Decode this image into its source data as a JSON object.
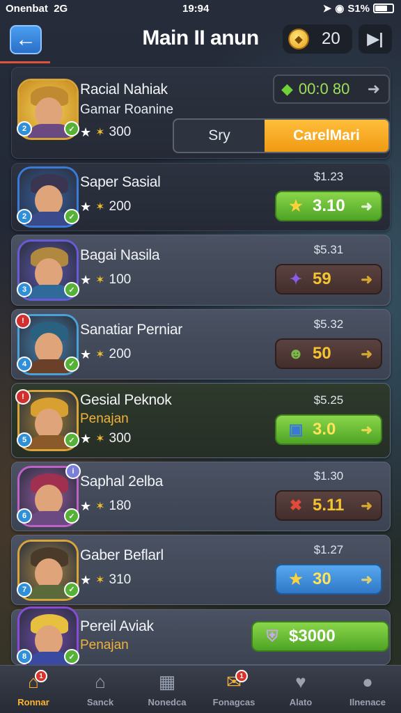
{
  "status": {
    "carrier": "Onenbat",
    "network": "2G",
    "time": "19:94",
    "battery": "S1%"
  },
  "header": {
    "title": "Main II anun",
    "coins": "20",
    "back_icon": "arrow-left-icon",
    "skip_icon": "skip-icon"
  },
  "top_card": {
    "name": "Racial Nahiak",
    "subtitle": "Gamar Roanine",
    "rating": "300",
    "timer": "00:0 80",
    "toggle_left": "Sry",
    "toggle_right": "CarelMari"
  },
  "items": [
    {
      "name": "Saper Sasial",
      "rating": "200",
      "price": "$1.23",
      "button": "3.10",
      "btn_style": "green",
      "icon": "star-icon",
      "hair": "#3a3550",
      "body": "#3a4a8a",
      "frame": "#3a7ad8"
    },
    {
      "name": "Bagai Nasila",
      "rating": "100",
      "price": "$5.31",
      "button": "59",
      "btn_style": "brown",
      "icon": "puzzle-icon",
      "hair": "#b08840",
      "body": "#2f6a9a",
      "frame": "#6a5ad8"
    },
    {
      "name": "Sanatiar Perniar",
      "rating": "200",
      "price": "$5.32",
      "button": "50",
      "btn_style": "brown",
      "icon": "character-icon",
      "hair": "#2a6080",
      "body": "#6a4028",
      "frame": "#4aa0d8"
    },
    {
      "name": "Gesial Peknok",
      "subtitle": "Penajan",
      "rating": "300",
      "price": "$5.25",
      "button": "3.0",
      "btn_style": "green",
      "icon": "card-icon",
      "hair": "#d8a030",
      "body": "#8a5a2a",
      "frame": "#d9a438"
    },
    {
      "name": "Saphal 2elba",
      "rating": "180",
      "price": "$1.30",
      "button": "5.11",
      "btn_style": "brown",
      "icon": "cross-icon",
      "hair": "#a03050",
      "body": "#6a4a80",
      "frame": "#c060c8"
    },
    {
      "name": "Gaber Beflarl",
      "rating": "310",
      "price": "$1.27",
      "button": "30",
      "btn_style": "blue",
      "icon": "star-icon",
      "hair": "#4a3a2a",
      "body": "#5a6a3a",
      "frame": "#d9a438"
    },
    {
      "name": "Pereil Aviak",
      "subtitle": "Penajan",
      "button": "$3000",
      "btn_style": "green",
      "icon": "shield-icon",
      "hair": "#e8c040",
      "body": "#3a4aa0",
      "frame": "#8a4ad8"
    }
  ],
  "nav": [
    {
      "label": "Ronnar",
      "icon": "home-icon",
      "active": true,
      "badge": "1"
    },
    {
      "label": "Sanck",
      "icon": "shop-icon",
      "active": false,
      "badge": ""
    },
    {
      "label": "Nonedca",
      "icon": "stats-icon",
      "active": false,
      "badge": ""
    },
    {
      "label": "Fonagcas",
      "icon": "gift-icon",
      "active": false,
      "badge": "1"
    },
    {
      "label": "Alato",
      "icon": "bird-icon",
      "active": false,
      "badge": ""
    },
    {
      "label": "Ilnenace",
      "icon": "profile-icon",
      "active": false,
      "badge": ""
    }
  ],
  "colors": {
    "accent": "#f5a623",
    "green": "#5cb82c",
    "panel": "#3c4352"
  }
}
